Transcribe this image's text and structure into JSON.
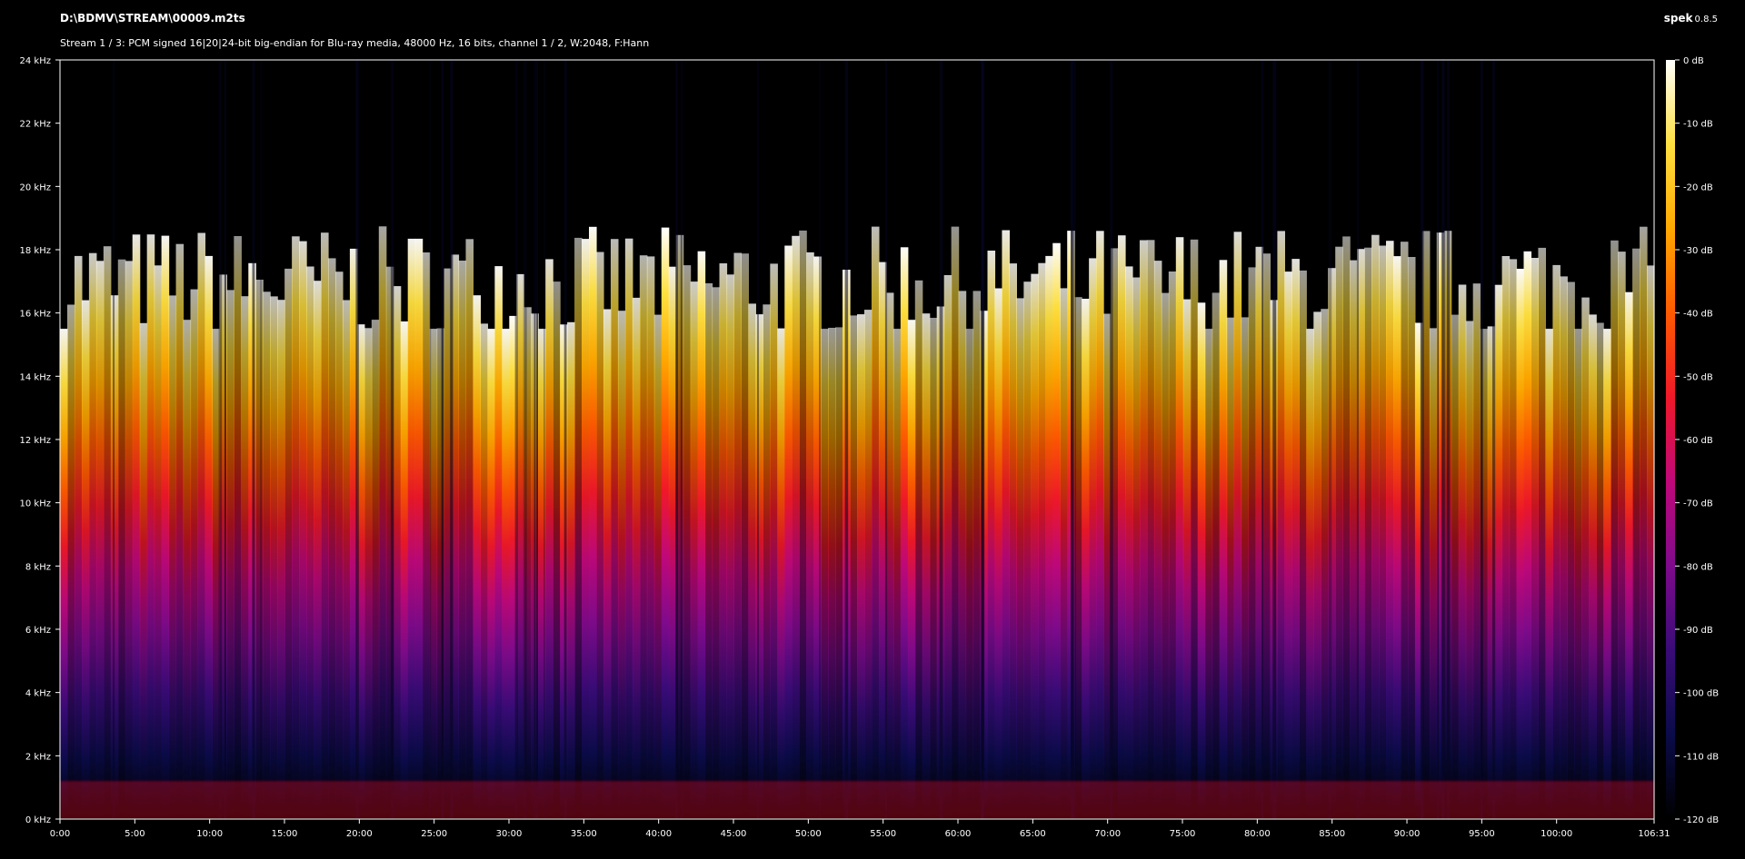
{
  "header": {
    "file_path": "D:\\BDMV\\STREAM\\00009.m2ts",
    "stream_info": "Stream 1 / 3: PCM signed 16|20|24-bit big-endian for Blu-ray media, 48000 Hz, 16 bits, channel 1 / 2, W:2048, F:Hann",
    "app_name": "spek",
    "app_version": "0.8.5"
  },
  "chart_data": {
    "type": "heatmap",
    "title": "",
    "x_ticks": [
      "0:00",
      "5:00",
      "10:00",
      "15:00",
      "20:00",
      "25:00",
      "30:00",
      "35:00",
      "40:00",
      "45:00",
      "50:00",
      "55:00",
      "60:00",
      "65:00",
      "70:00",
      "75:00",
      "80:00",
      "85:00",
      "90:00",
      "95:00",
      "100:00",
      "106:31"
    ],
    "x_range_seconds": [
      0,
      6391
    ],
    "y_ticks": [
      "0 kHz",
      "2 kHz",
      "4 kHz",
      "6 kHz",
      "8 kHz",
      "10 kHz",
      "12 kHz",
      "14 kHz",
      "16 kHz",
      "18 kHz",
      "20 kHz",
      "22 kHz",
      "24 kHz"
    ],
    "y_range_khz": [
      0,
      24
    ],
    "color_scale": {
      "labels": [
        "0 dB",
        "-10 dB",
        "-20 dB",
        "-30 dB",
        "-40 dB",
        "-50 dB",
        "-60 dB",
        "-70 dB",
        "-80 dB",
        "-90 dB",
        "-100 dB",
        "-110 dB",
        "-120 dB"
      ],
      "range_db": [
        -120,
        0
      ],
      "stops": [
        "#000000",
        "#0b0b4a",
        "#3a0b78",
        "#800a8c",
        "#c0087a",
        "#f01828",
        "#ff5a00",
        "#ffa800",
        "#ffe040",
        "#ffffff"
      ]
    },
    "envelope_cutoff_khz": {
      "mean": 17,
      "min": 15.5,
      "max": 20
    },
    "grid": false
  }
}
